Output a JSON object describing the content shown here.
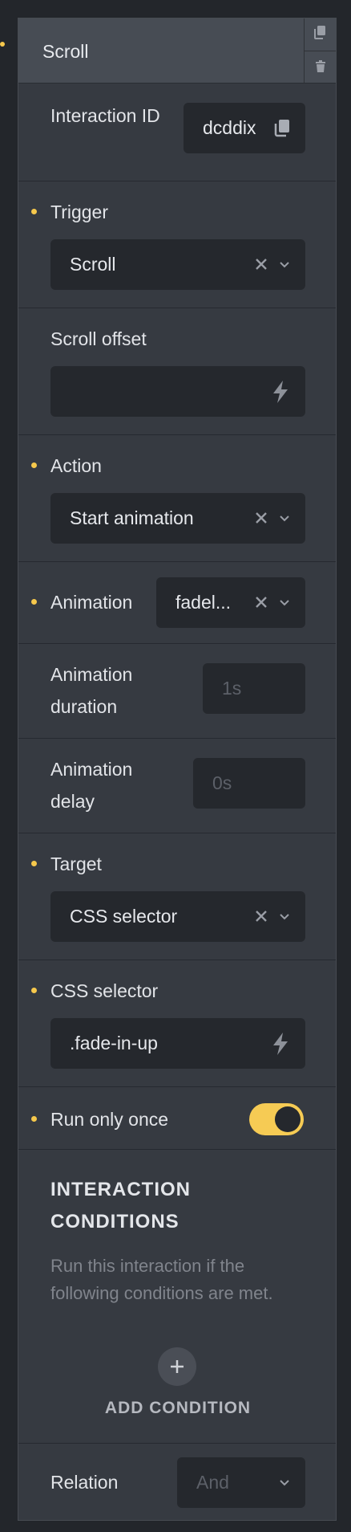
{
  "header": {
    "title": "Scroll"
  },
  "interaction_id": {
    "label": "Interaction ID",
    "value": "dcddix"
  },
  "trigger": {
    "label": "Trigger",
    "value": "Scroll"
  },
  "scroll_offset": {
    "label": "Scroll offset",
    "value": ""
  },
  "action": {
    "label": "Action",
    "value": "Start animation"
  },
  "animation": {
    "label": "Animation",
    "value": "fadel..."
  },
  "animation_duration": {
    "label": "Animation duration",
    "placeholder": "1s"
  },
  "animation_delay": {
    "label": "Animation delay",
    "placeholder": "0s"
  },
  "target": {
    "label": "Target",
    "value": "CSS selector"
  },
  "css_selector": {
    "label": "CSS selector",
    "value": ".fade-in-up"
  },
  "run_only_once": {
    "label": "Run only once",
    "enabled": true
  },
  "conditions": {
    "title": "INTERACTION CONDITIONS",
    "description": "Run this interaction if the following conditions are met.",
    "add_label": "ADD CONDITION"
  },
  "relation": {
    "label": "Relation",
    "placeholder": "And"
  },
  "colors": {
    "accent": "#f6c84c",
    "panel": "#363a41",
    "field": "#25282d"
  },
  "icons": [
    "copy-icon",
    "trash-icon",
    "clipboard-icon",
    "clear-icon",
    "chevron-down-icon",
    "bolt-icon",
    "plus-icon"
  ]
}
